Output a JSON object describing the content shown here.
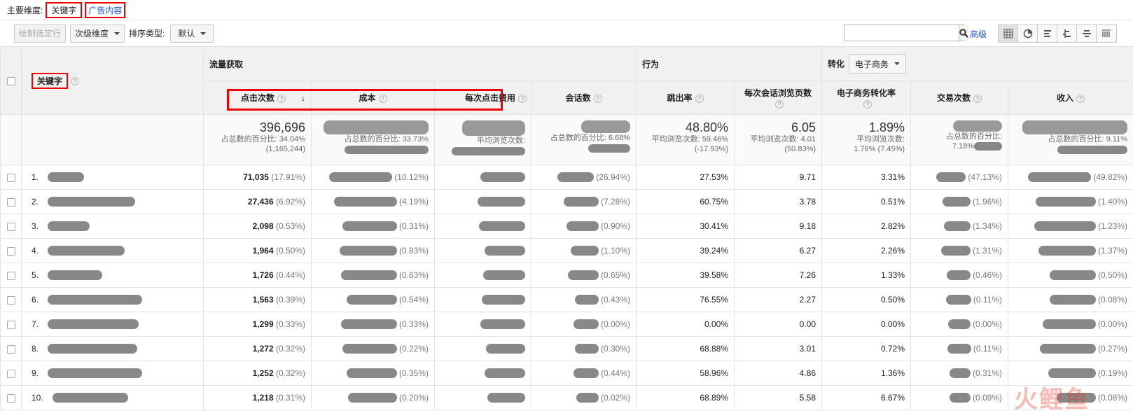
{
  "dimension_bar": {
    "label": "主要维度:",
    "active": "关键字",
    "link": "广告内容"
  },
  "toolbar": {
    "plot_rows": "绘制选定行",
    "secondary_dim": "次级维度",
    "sort_label": "排序类型:",
    "sort_value": "默认",
    "search_placeholder": "",
    "advanced": "高级"
  },
  "groups": {
    "acquisition": "流量获取",
    "behavior": "行为",
    "conversion": "转化",
    "conversion_select": "电子商务"
  },
  "columns": {
    "keyword": "关键字",
    "clicks": "点击次数",
    "cost": "成本",
    "cpc": "每次点击费用",
    "sessions": "会话数",
    "bounce": "跳出率",
    "pages_per_session": "每次会话浏览页数",
    "ecom_rate": "电子商务转化率",
    "transactions": "交易次数",
    "revenue": "收入"
  },
  "totals": {
    "clicks": "396,696",
    "clicks_sub1": "占总数的百分比: 34.04%",
    "clicks_sub2": "(1,165,244)",
    "cost_sub": "占总数的百分比: 33.73%",
    "cpc_sub": "平均浏览次数:",
    "sessions_sub": "占总数的百分比: 6.68%",
    "bounce": "48.80%",
    "bounce_sub1": "平均浏览次数: 59.46%",
    "bounce_sub2": "(-17.93%)",
    "pps": "6.05",
    "pps_sub1": "平均浏览次数: 4.01",
    "pps_sub2": "(50.83%)",
    "ecom": "1.89%",
    "ecom_sub1": "平均浏览次数:",
    "ecom_sub2": "1.76% (7.45%)",
    "trans_sub1": "占总数的百分比:",
    "trans_sub2": "7.18%",
    "rev_sub": "占总数的百分比: 9.11%"
  },
  "rows": [
    {
      "idx": "1.",
      "clicks": "71,035",
      "clicks_pct": "(17.91%)",
      "cost_pct": "(10.12%)",
      "sess_pct": "(26.94%)",
      "bounce": "27.53%",
      "pps": "9.71",
      "ecom": "3.31%",
      "trans_pct": "(47.13%)",
      "rev_pct": "(49.82%)"
    },
    {
      "idx": "2.",
      "clicks": "27,436",
      "clicks_pct": "(6.92%)",
      "cost_pct": "(4.19%)",
      "sess_pct": "(7.28%)",
      "bounce": "60.75%",
      "pps": "3.78",
      "ecom": "0.51%",
      "trans_pct": "(1.96%)",
      "rev_pct": "(1.40%)"
    },
    {
      "idx": "3.",
      "clicks": "2,098",
      "clicks_pct": "(0.53%)",
      "cost_pct": "(0.31%)",
      "sess_pct": "(0.90%)",
      "bounce": "30.41%",
      "pps": "9.18",
      "ecom": "2.82%",
      "trans_pct": "(1.34%)",
      "rev_pct": "(1.23%)"
    },
    {
      "idx": "4.",
      "clicks": "1,964",
      "clicks_pct": "(0.50%)",
      "cost_pct": "(0.83%)",
      "sess_pct": "(1.10%)",
      "bounce": "39.24%",
      "pps": "6.27",
      "ecom": "2.26%",
      "trans_pct": "(1.31%)",
      "rev_pct": "(1.37%)"
    },
    {
      "idx": "5.",
      "clicks": "1,726",
      "clicks_pct": "(0.44%)",
      "cost_pct": "(0.63%)",
      "sess_pct": "(0.65%)",
      "bounce": "39.58%",
      "pps": "7.26",
      "ecom": "1.33%",
      "trans_pct": "(0.46%)",
      "rev_pct": "(0.50%)"
    },
    {
      "idx": "6.",
      "clicks": "1,563",
      "clicks_pct": "(0.39%)",
      "cost_pct": "(0.54%)",
      "sess_pct": "(0.43%)",
      "bounce": "76.55%",
      "pps": "2.27",
      "ecom": "0.50%",
      "trans_pct": "(0.11%)",
      "rev_pct": "(0.08%)"
    },
    {
      "idx": "7.",
      "clicks": "1,299",
      "clicks_pct": "(0.33%)",
      "cost_pct": "(0.33%)",
      "sess_pct": "(0.00%)",
      "bounce": "0.00%",
      "pps": "0.00",
      "ecom": "0.00%",
      "trans_pct": "(0.00%)",
      "rev_pct": "(0.00%)"
    },
    {
      "idx": "8.",
      "clicks": "1,272",
      "clicks_pct": "(0.32%)",
      "cost_pct": "(0.22%)",
      "sess_pct": "(0.30%)",
      "bounce": "68.88%",
      "pps": "3.01",
      "ecom": "0.72%",
      "trans_pct": "(0.11%)",
      "rev_pct": "(0.27%)"
    },
    {
      "idx": "9.",
      "clicks": "1,252",
      "clicks_pct": "(0.32%)",
      "cost_pct": "(0.35%)",
      "sess_pct": "(0.44%)",
      "bounce": "58.96%",
      "pps": "4.86",
      "ecom": "1.36%",
      "trans_pct": "(0.31%)",
      "rev_pct": "(0.19%)"
    },
    {
      "idx": "10.",
      "clicks": "1,218",
      "clicks_pct": "(0.31%)",
      "cost_pct": "(0.20%)",
      "sess_pct": "(0.02%)",
      "bounce": "68.89%",
      "pps": "5.58",
      "ecom": "6.67%",
      "trans_pct": "(0.09%)",
      "rev_pct": "(0.08%)"
    }
  ],
  "watermark": "火鲤鱼"
}
